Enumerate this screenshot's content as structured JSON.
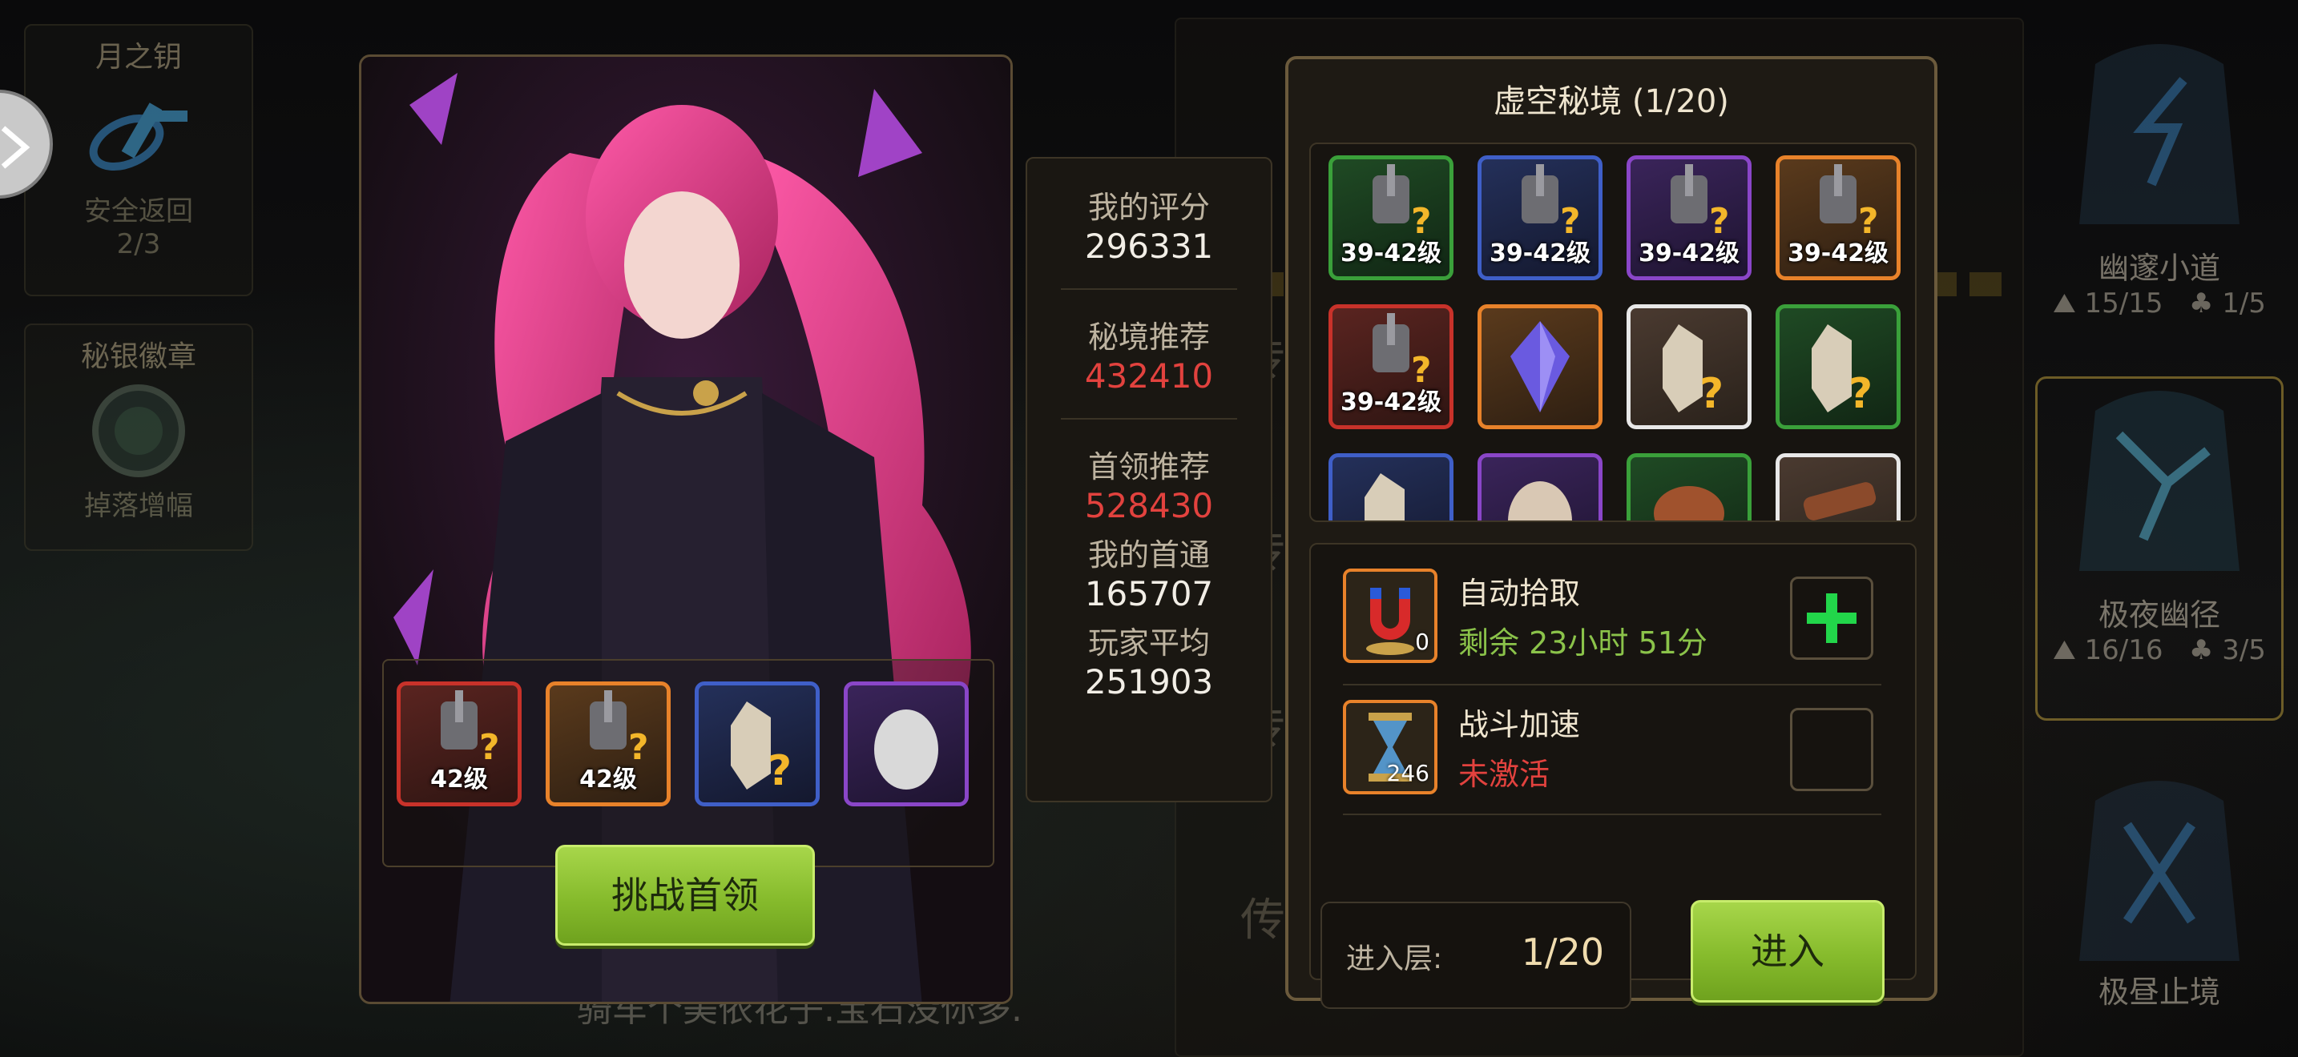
{
  "left_cards": [
    {
      "title": "月之钥",
      "icon": "moon-key-icon",
      "label": "安全返回",
      "count": "2/3"
    },
    {
      "title": "秘银徽章",
      "icon": "mithril-badge-icon",
      "label": "掉落增幅"
    }
  ],
  "boss_panel": {
    "rewards": [
      {
        "icon": "armor-mystery-icon",
        "rarity": "red",
        "level": "42级"
      },
      {
        "icon": "armor-mystery-icon",
        "rarity": "orange",
        "level": "42级"
      },
      {
        "icon": "crystal-mystery-icon",
        "rarity": "blue",
        "level": ""
      },
      {
        "icon": "egg-icon",
        "rarity": "purple",
        "level": ""
      }
    ],
    "challenge_button": "挑战首领"
  },
  "stats": {
    "my_score_label": "我的评分",
    "my_score": "296331",
    "dungeon_rec_label": "秘境推荐",
    "dungeon_rec": "432410",
    "boss_rec_label": "首领推荐",
    "boss_rec": "528430",
    "my_first_clear_label": "我的首通",
    "my_first_clear": "165707",
    "player_avg_label": "玩家平均",
    "player_avg": "251903"
  },
  "dungeon": {
    "title": "虚空秘境 (1/20)",
    "items": [
      {
        "icon": "armor-mystery-icon",
        "rarity": "green",
        "level": "39-42级"
      },
      {
        "icon": "armor-mystery-icon",
        "rarity": "blue",
        "level": "39-42级"
      },
      {
        "icon": "armor-mystery-icon",
        "rarity": "purple",
        "level": "39-42级"
      },
      {
        "icon": "armor-mystery-icon",
        "rarity": "orange",
        "level": "39-42级"
      },
      {
        "icon": "armor-mystery-icon",
        "rarity": "red",
        "level": "39-42级"
      },
      {
        "icon": "purple-crystal-icon",
        "rarity": "orange",
        "level": ""
      },
      {
        "icon": "crystal-mystery-icon",
        "rarity": "white",
        "level": ""
      },
      {
        "icon": "crystal-mystery-icon",
        "rarity": "green",
        "level": ""
      },
      {
        "icon": "crystal-mystery-icon",
        "rarity": "blue",
        "level": ""
      },
      {
        "icon": "egg-icon",
        "rarity": "purple",
        "level": ""
      },
      {
        "icon": "ore-icon",
        "rarity": "green",
        "level": ""
      },
      {
        "icon": "wood-icon",
        "rarity": "white",
        "level": ""
      }
    ],
    "auto_pickup": {
      "icon": "magnet-icon",
      "count": "0",
      "name": "自动拾取",
      "status": "剩余 23小时 51分",
      "status_color": "#8bc34a",
      "button_icon": "plus-icon"
    },
    "battle_speed": {
      "icon": "hourglass-icon",
      "count": "246",
      "name": "战斗加速",
      "status": "未激活",
      "status_color": "#e2423e"
    },
    "floor_label": "进入层:",
    "floor_value": "1/20",
    "enter_button": "进入"
  },
  "bg_chat": "骑车个美依花子.宝石没你多.",
  "bg_list_items": [
    "传",
    "传",
    "传",
    "传",
    "传"
  ],
  "right_nodes": [
    {
      "name": "幽邃小道",
      "left": "15/15",
      "right": "1/5"
    },
    {
      "name": "极夜幽径",
      "left": "16/16",
      "right": "3/5"
    },
    {
      "name": "极昼止境"
    }
  ],
  "colors": {
    "accent_green": "#86bb2c",
    "red_value": "#e2423e",
    "panel_border": "#6b5a3c"
  }
}
